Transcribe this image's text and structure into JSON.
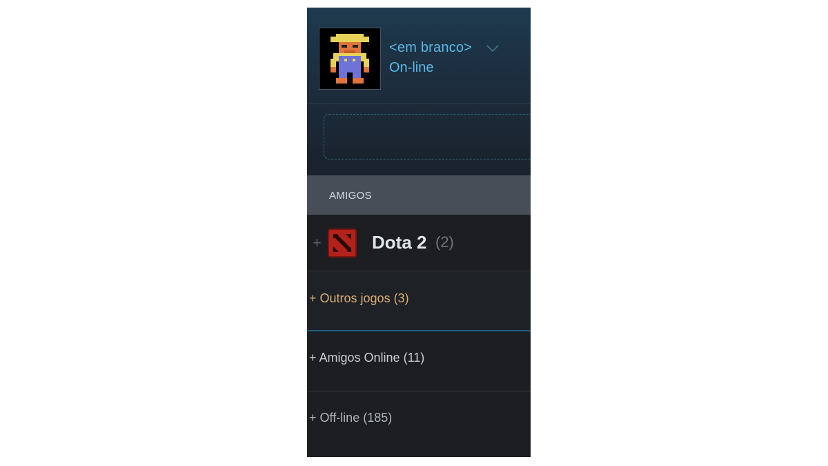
{
  "profile": {
    "username": "<em branco>",
    "status": "On-line",
    "avatar_icon": "pixel-farmer-avatar",
    "name_color": "#5cb8e6"
  },
  "friends_header": {
    "label": "AMIGOS"
  },
  "game_group": {
    "expand_icon": "+",
    "game_icon": "dota-2-icon",
    "title": "Dota 2",
    "count": "(2)",
    "accent_color": "#b2221b"
  },
  "groups": [
    {
      "label": "+ Outros jogos (3)",
      "color": "#d9ad72"
    },
    {
      "label": "+ Amigos Online (11)",
      "color": "#c9cdd2"
    },
    {
      "label": "+ Off-line (185)",
      "color": "#aeb3b9"
    }
  ]
}
